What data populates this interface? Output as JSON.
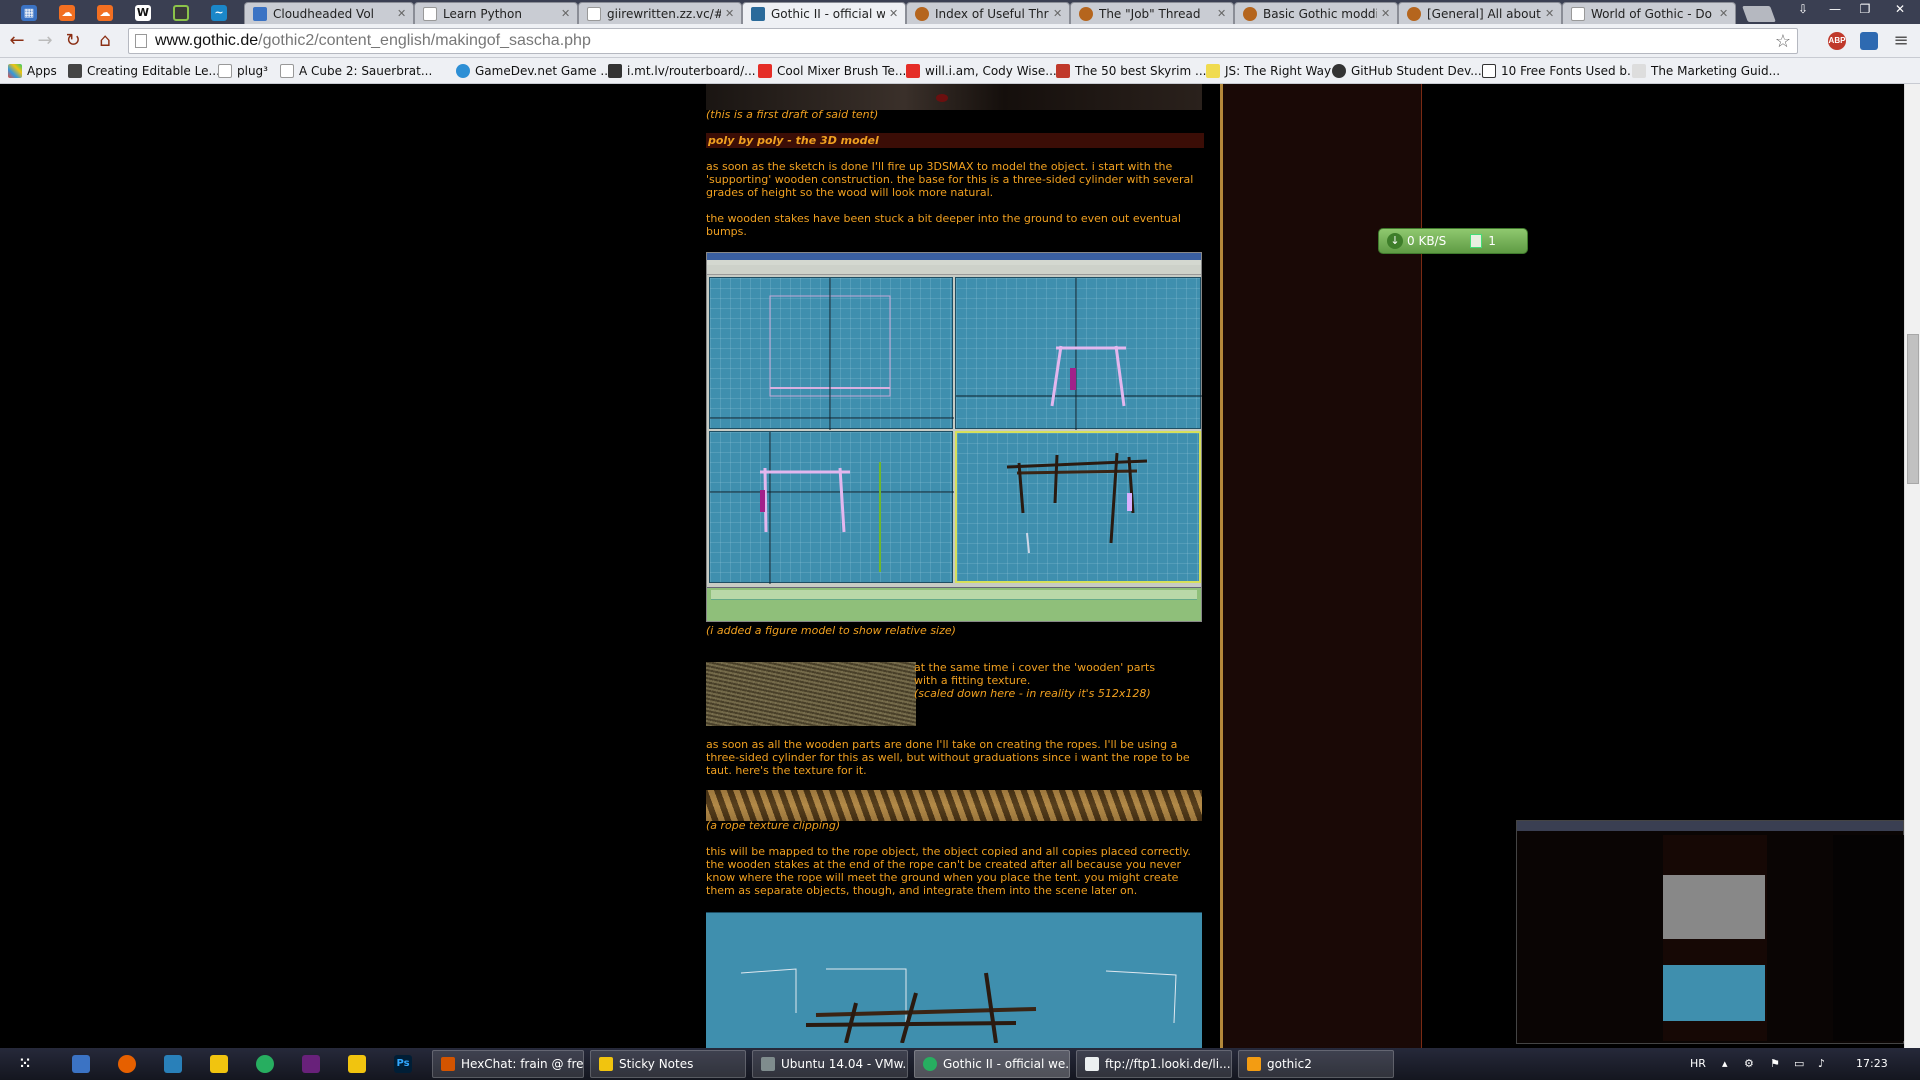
{
  "browser": {
    "tabs": [
      {
        "label": "Cloudheaded Vol",
        "color": "#3b73c4"
      },
      {
        "label": "Learn Python",
        "color": "#ffffff"
      },
      {
        "label": "giirewritten.zz.vc/#",
        "color": "#ffffff"
      },
      {
        "label": "Gothic II - official we",
        "color": "#2a6a9a",
        "active": true
      },
      {
        "label": "Index of Useful Threa",
        "color": "#b5651d"
      },
      {
        "label": "The \"Job\" Thread",
        "color": "#b5651d"
      },
      {
        "label": "Basic Gothic moddin",
        "color": "#b5651d"
      },
      {
        "label": "[General] All about sc",
        "color": "#b5651d"
      },
      {
        "label": "World of Gothic - Do",
        "color": "#ffffff"
      }
    ],
    "pinned_icons": [
      "windows-icon",
      "soundcloud-icon",
      "soundcloud-icon",
      "wikipedia-icon",
      "green-circle-icon",
      "wave-icon"
    ],
    "address": {
      "host": "www.gothic.de",
      "path": "/gothic2/content_english/makingof_sascha.php"
    },
    "extensions": [
      {
        "label": "ABP",
        "color": "#c0392b"
      },
      {
        "label": "",
        "color": "#2e6ab1"
      }
    ],
    "bookmarks": [
      "Apps",
      "Creating Editable Le...",
      "plug³",
      "A Cube 2: Sauerbrat...",
      "GameDev.net Game ...",
      "i.mt.lv/routerboard/...",
      "Cool Mixer Brush Te...",
      "will.i.am, Cody Wise...",
      "The 50 best Skyrim ...",
      "JS: The Right Way",
      "GitHub Student Dev...",
      "10 Free Fonts Used b...",
      "The Marketing Guid..."
    ]
  },
  "article": {
    "caption_tent": "(this is a first draft of said tent)",
    "heading": "poly by poly - the 3D model",
    "para1": "as soon as the sketch is done I'll fire up 3DSMAX to model the object. i start with the 'supporting' wooden construction. the base for this is a three-sided cylinder with several grades of height so the wood will look more natural.",
    "para2": "the wooden stakes have been stuck a bit deeper into the ground to even out eventual bumps.",
    "caption_figure": "(i added a figure model to show relative size)",
    "texture_text": "at the same time i cover the 'wooden' parts with a fitting texture.",
    "texture_caption": "(scaled down here - in reality it's 512x128)",
    "para3": "as soon as all the wooden parts are done I'll take on creating the ropes. I'll be using a three-sided cylinder for this as well, but without graduations since i want the rope to be taut. here's the texture for it.",
    "caption_rope": "(a rope texture clipping)",
    "para4": "this will be mapped to the rope object, the object copied and all copies placed correctly. the wooden stakes at the end of the rope can't be created after all because you never know where the rope will meet the ground when you place the tent. you might create them as separate objects, though, and integrate them into the scene later on."
  },
  "download_widget": {
    "speed": "0 KB/S",
    "count": "1"
  },
  "taskbar": {
    "quick_icons": [
      "apps-grid-icon",
      "explorer-icon",
      "firefox-icon",
      "window-icon",
      "pen-icon",
      "green-app-icon",
      "visual-studio-icon",
      "notes-icon",
      "photoshop-icon"
    ],
    "tasks": [
      {
        "label": "HexChat: frain @ fre...",
        "color": "#d35400"
      },
      {
        "label": "Sticky Notes",
        "color": "#f1c40f"
      },
      {
        "label": "Ubuntu 14.04 - VMw...",
        "color": "#7f8c8d"
      },
      {
        "label": "Gothic II - official we...",
        "color": "#27ae60",
        "active": true
      },
      {
        "label": "ftp://ftp1.looki.de/li...",
        "color": "#ecf0f1"
      },
      {
        "label": "gothic2",
        "color": "#f39c12"
      }
    ],
    "lang": "HR",
    "time": "17:23"
  }
}
